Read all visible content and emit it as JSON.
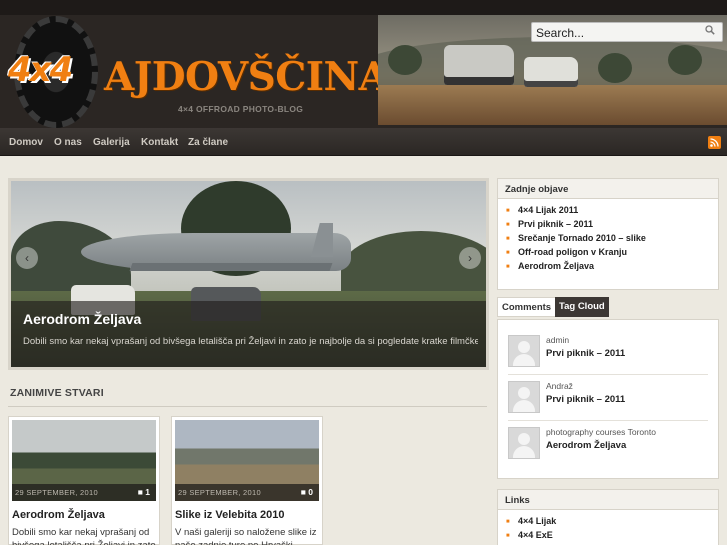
{
  "header": {
    "logo_badge": "4x4",
    "logo_title": "AJDOVŠČINA",
    "logo_subtitle": "4×4 OFFROAD PHOTO-BLOG",
    "search_placeholder": "Search...",
    "search_icon": "magnifier-icon"
  },
  "nav": {
    "items": [
      "Domov",
      "O nas",
      "Galerija",
      "Kontakt",
      "Za člane"
    ],
    "rss_icon": "rss-icon"
  },
  "slider": {
    "title": "Aerodrom Željava",
    "text": "Dobili smo kar nekaj vprašanj od bivšega letališča pri Željavi in zato je najbolje da si pogledate kratke filmčke: ...",
    "prev_label": "‹",
    "next_label": "›"
  },
  "section": {
    "title": "ZANIMIVE STVARI"
  },
  "cards": [
    {
      "date": "29 SEPTEMBER, 2010",
      "comments": "1",
      "title": "Aerodrom Željava",
      "text": "Dobili smo kar nekaj vprašanj od bivšega letališča pri Željavi in zato"
    },
    {
      "date": "29 SEPTEMBER, 2010",
      "comments": "0",
      "title": "Slike iz Velebita 2010",
      "text": "V naši galeriji so naložene slike iz naše zadnje ture po Hrvaški –"
    }
  ],
  "sidebar": {
    "recent_title": "Zadnje objave",
    "recent_posts": [
      "4×4 Lijak 2011",
      "Prvi piknik – 2011",
      "Srečanje Tornado 2010 – slike",
      "Off-road poligon v Kranju",
      "Aerodrom Željava"
    ],
    "tabs": [
      "Comments",
      "Tag Cloud"
    ],
    "comments": [
      {
        "author": "admin",
        "post": "Prvi piknik – 2011"
      },
      {
        "author": "Andraž",
        "post": "Prvi piknik – 2011"
      },
      {
        "author": "photography courses Toronto",
        "post": "Aerodrom Željava"
      }
    ],
    "links_title": "Links",
    "links": [
      "4×4 Lijak",
      "4×4 ExE"
    ]
  },
  "colors": {
    "accent": "#f07f12",
    "header_bg": "#2b2623",
    "page_bg": "#ece9e0"
  }
}
